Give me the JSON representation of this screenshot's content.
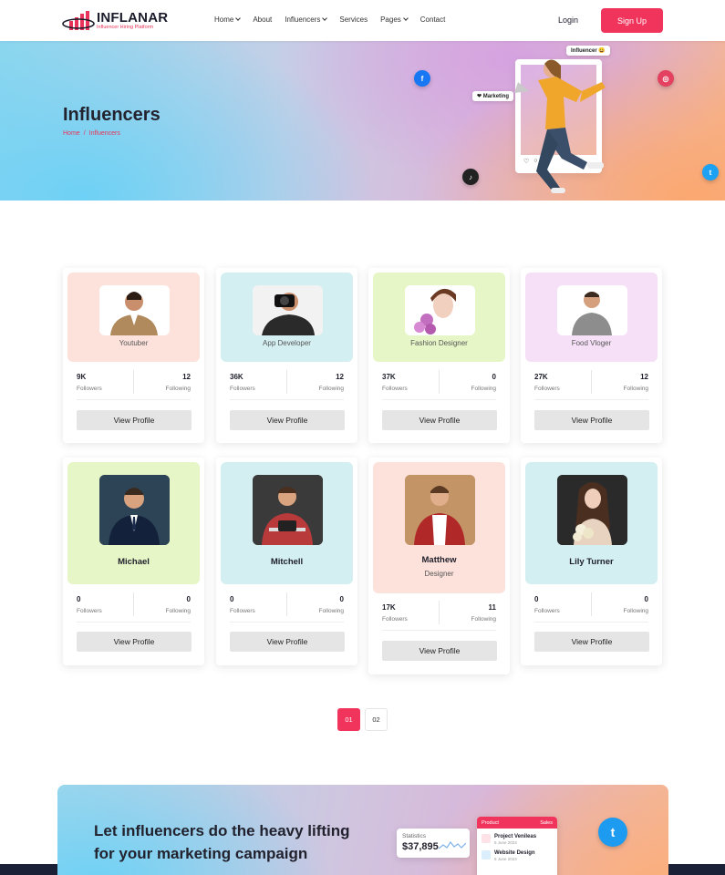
{
  "header": {
    "logo_title": "INFLANAR",
    "logo_subtitle": "Influencer Hiring Platform",
    "nav": [
      {
        "label": "Home",
        "dropdown": true
      },
      {
        "label": "About",
        "dropdown": false
      },
      {
        "label": "Influencers",
        "dropdown": true
      },
      {
        "label": "Services",
        "dropdown": false
      },
      {
        "label": "Pages",
        "dropdown": true
      },
      {
        "label": "Contact",
        "dropdown": false
      }
    ],
    "login": "Login",
    "signup": "Sign Up"
  },
  "hero": {
    "title": "Influencers",
    "breadcrumb": {
      "home": "Home",
      "separator": "/",
      "current": "Influencers"
    },
    "tag_influencer": "Influencer 😀",
    "tag_marketing": "❤ Marketing",
    "accent_color": "#f0345c"
  },
  "cards": [
    {
      "role": "Youtuber",
      "name": "",
      "followers": "9K",
      "following": "12",
      "followers_label": "Followers",
      "following_label": "Following",
      "button": "View Profile",
      "bg": "#fde2dc"
    },
    {
      "role": "App Developer",
      "name": "",
      "followers": "36K",
      "following": "12",
      "followers_label": "Followers",
      "following_label": "Following",
      "button": "View Profile",
      "bg": "#d4eff2"
    },
    {
      "role": "Fashion Designer",
      "name": "",
      "followers": "37K",
      "following": "0",
      "followers_label": "Followers",
      "following_label": "Following",
      "button": "View Profile",
      "bg": "#e6f6c7"
    },
    {
      "role": "Food Vloger",
      "name": "",
      "followers": "27K",
      "following": "12",
      "followers_label": "Followers",
      "following_label": "Following",
      "button": "View Profile",
      "bg": "#f6e0f7"
    },
    {
      "role": "",
      "name": "Michael",
      "followers": "0",
      "following": "0",
      "followers_label": "Followers",
      "following_label": "Following",
      "button": "View Profile",
      "bg": "#e6f6c7"
    },
    {
      "role": "",
      "name": "Mitchell",
      "followers": "0",
      "following": "0",
      "followers_label": "Followers",
      "following_label": "Following",
      "button": "View Profile",
      "bg": "#d4eff2"
    },
    {
      "role": "Designer",
      "name": "Matthew",
      "followers": "17K",
      "following": "11",
      "followers_label": "Followers",
      "following_label": "Following",
      "button": "View Profile",
      "bg": "#fde2dc"
    },
    {
      "role": "",
      "name": "Lily Turner",
      "followers": "0",
      "following": "0",
      "followers_label": "Followers",
      "following_label": "Following",
      "button": "View Profile",
      "bg": "#d4eff2"
    }
  ],
  "pagination": {
    "pages": [
      "01",
      "02"
    ],
    "active": "01"
  },
  "cta": {
    "title": "Let influencers do the heavy lifting for your marketing campaign",
    "stat_label": "Statistics",
    "stat_value": "$37,895",
    "product_header": "Product",
    "sales_header": "Sales",
    "product_1": "Project Venileas",
    "product_1_date": "5 June 2023",
    "product_2": "Website Design",
    "product_2_date": "5 June 2023"
  }
}
